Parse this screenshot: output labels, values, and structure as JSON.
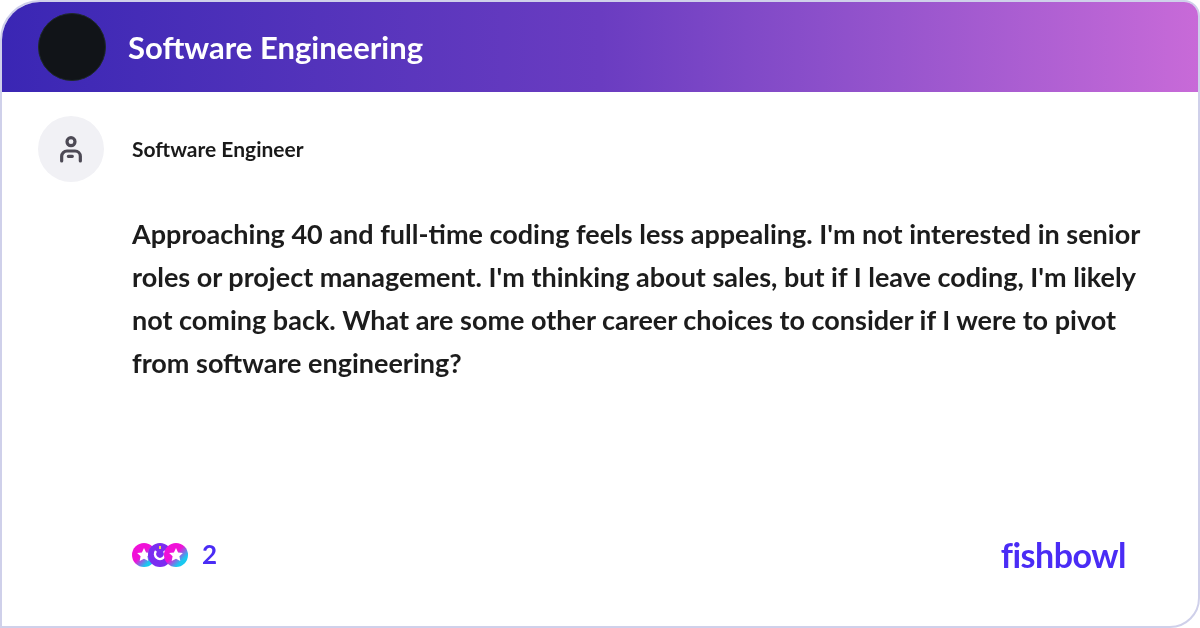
{
  "header": {
    "title": "Software Engineering"
  },
  "author": {
    "name": "Software Engineer"
  },
  "post": {
    "text": "Approaching 40 and full-time coding feels less appealing. I'm not interested in senior roles or project management. I'm thinking about sales, but if I leave coding, I'm likely not coming back. What are some other career choices to consider if I were to pivot from software engineering?"
  },
  "reactions": {
    "count": "2"
  },
  "brand": {
    "logo": "fishbowl"
  }
}
